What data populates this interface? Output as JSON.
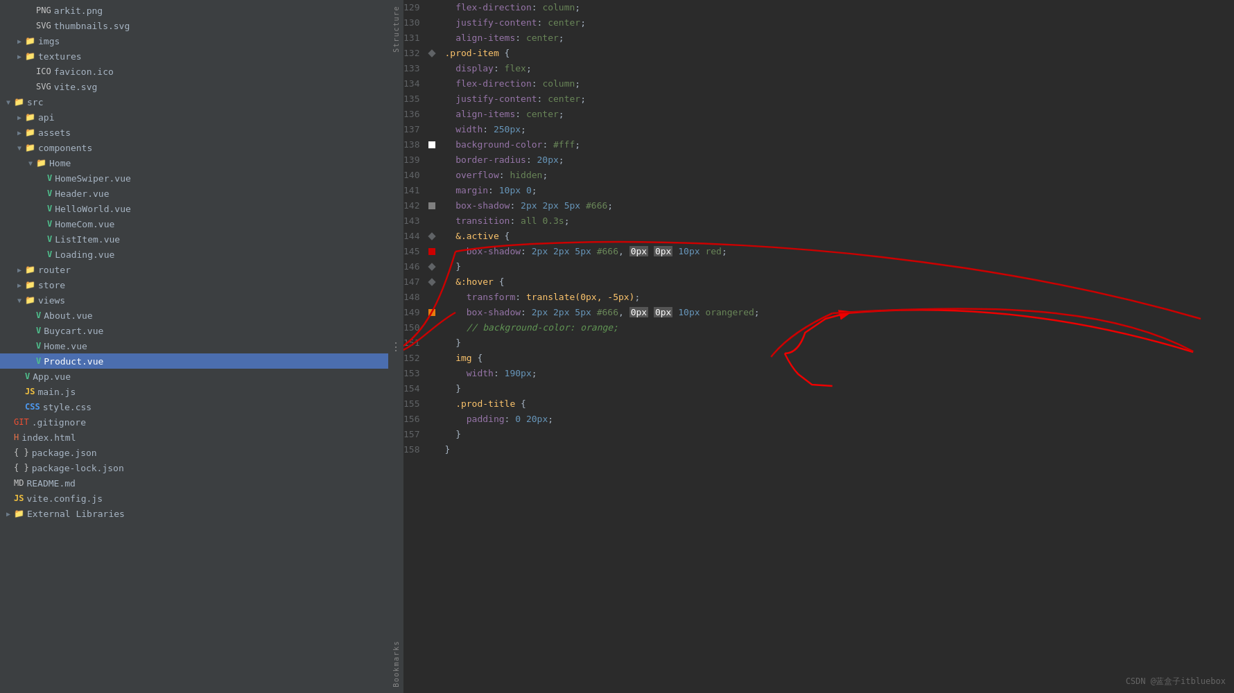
{
  "sidebar": {
    "title": "Structure",
    "bookmarks_label": "Bookmarks",
    "structure_label": "Structure",
    "tree": [
      {
        "id": "arkit-png",
        "indent": 2,
        "type": "file",
        "icon": "img",
        "name": "arkit.png"
      },
      {
        "id": "thumbnails-svg",
        "indent": 2,
        "type": "file",
        "icon": "svg",
        "name": "thumbnails.svg"
      },
      {
        "id": "imgs",
        "indent": 1,
        "type": "folder",
        "icon": "folder",
        "name": "imgs",
        "arrow": "▶"
      },
      {
        "id": "textures",
        "indent": 1,
        "type": "folder",
        "icon": "folder",
        "name": "textures",
        "arrow": "▶"
      },
      {
        "id": "favicon-ico",
        "indent": 2,
        "type": "file",
        "icon": "ico",
        "name": "favicon.ico"
      },
      {
        "id": "vite-svg",
        "indent": 2,
        "type": "file",
        "icon": "svg",
        "name": "vite.svg"
      },
      {
        "id": "src",
        "indent": 0,
        "type": "folder",
        "icon": "folder",
        "name": "src",
        "arrow": "▼"
      },
      {
        "id": "api",
        "indent": 1,
        "type": "folder",
        "icon": "folder",
        "name": "api",
        "arrow": "▶"
      },
      {
        "id": "assets",
        "indent": 1,
        "type": "folder",
        "icon": "folder",
        "name": "assets",
        "arrow": "▶"
      },
      {
        "id": "components",
        "indent": 1,
        "type": "folder",
        "icon": "folder",
        "name": "components",
        "arrow": "▼"
      },
      {
        "id": "home-folder",
        "indent": 2,
        "type": "folder",
        "icon": "folder",
        "name": "Home",
        "arrow": "▼"
      },
      {
        "id": "homeswiper-vue",
        "indent": 3,
        "type": "file",
        "icon": "vue",
        "name": "HomeSwiper.vue"
      },
      {
        "id": "header-vue",
        "indent": 3,
        "type": "file",
        "icon": "vue",
        "name": "Header.vue"
      },
      {
        "id": "helloworld-vue",
        "indent": 3,
        "type": "file",
        "icon": "vue",
        "name": "HelloWorld.vue"
      },
      {
        "id": "homecom-vue",
        "indent": 3,
        "type": "file",
        "icon": "vue",
        "name": "HomeCom.vue"
      },
      {
        "id": "listitem-vue",
        "indent": 3,
        "type": "file",
        "icon": "vue",
        "name": "ListItem.vue"
      },
      {
        "id": "loading-vue",
        "indent": 3,
        "type": "file",
        "icon": "vue",
        "name": "Loading.vue"
      },
      {
        "id": "router",
        "indent": 1,
        "type": "folder",
        "icon": "folder",
        "name": "router",
        "arrow": "▶"
      },
      {
        "id": "store",
        "indent": 1,
        "type": "folder",
        "icon": "folder",
        "name": "store",
        "arrow": "▶"
      },
      {
        "id": "views",
        "indent": 1,
        "type": "folder",
        "icon": "folder",
        "name": "views",
        "arrow": "▼"
      },
      {
        "id": "about-vue",
        "indent": 2,
        "type": "file",
        "icon": "vue",
        "name": "About.vue"
      },
      {
        "id": "buycart-vue",
        "indent": 2,
        "type": "file",
        "icon": "vue",
        "name": "Buycart.vue"
      },
      {
        "id": "home-vue",
        "indent": 2,
        "type": "file",
        "icon": "vue",
        "name": "Home.vue"
      },
      {
        "id": "product-vue",
        "indent": 2,
        "type": "file",
        "icon": "vue",
        "name": "Product.vue",
        "selected": true
      },
      {
        "id": "app-vue",
        "indent": 1,
        "type": "file",
        "icon": "vue",
        "name": "App.vue"
      },
      {
        "id": "main-js",
        "indent": 1,
        "type": "file",
        "icon": "js",
        "name": "main.js"
      },
      {
        "id": "style-css",
        "indent": 1,
        "type": "file",
        "icon": "css",
        "name": "style.css"
      },
      {
        "id": "gitignore",
        "indent": 0,
        "type": "file",
        "icon": "git",
        "name": ".gitignore"
      },
      {
        "id": "index-html",
        "indent": 0,
        "type": "file",
        "icon": "html",
        "name": "index.html"
      },
      {
        "id": "package-json",
        "indent": 0,
        "type": "file",
        "icon": "json",
        "name": "package.json"
      },
      {
        "id": "package-lock-json",
        "indent": 0,
        "type": "file",
        "icon": "json",
        "name": "package-lock.json"
      },
      {
        "id": "readme-md",
        "indent": 0,
        "type": "file",
        "icon": "md",
        "name": "README.md"
      },
      {
        "id": "vite-config-js",
        "indent": 0,
        "type": "file",
        "icon": "js",
        "name": "vite.config.js"
      },
      {
        "id": "external-libs",
        "indent": 0,
        "type": "folder",
        "icon": "folder",
        "name": "External Libraries",
        "arrow": "▶"
      }
    ]
  },
  "editor": {
    "lines": [
      {
        "num": 129,
        "gutter": "none",
        "code": "  flex-direction: column;",
        "tokens": [
          {
            "text": "  ",
            "class": ""
          },
          {
            "text": "flex-direction",
            "class": "c-property"
          },
          {
            "text": ": ",
            "class": "c-colon"
          },
          {
            "text": "column",
            "class": "c-value"
          },
          {
            "text": ";",
            "class": "c-white"
          }
        ]
      },
      {
        "num": 130,
        "gutter": "none",
        "code": "  justify-content: center;",
        "tokens": [
          {
            "text": "  ",
            "class": ""
          },
          {
            "text": "justify-content",
            "class": "c-property"
          },
          {
            "text": ": ",
            "class": "c-colon"
          },
          {
            "text": "center",
            "class": "c-value"
          },
          {
            "text": ";",
            "class": "c-white"
          }
        ]
      },
      {
        "num": 131,
        "gutter": "none",
        "code": "  align-items: center;",
        "tokens": [
          {
            "text": "  ",
            "class": ""
          },
          {
            "text": "align-items",
            "class": "c-property"
          },
          {
            "text": ": ",
            "class": "c-colon"
          },
          {
            "text": "center",
            "class": "c-value"
          },
          {
            "text": ";",
            "class": "c-white"
          }
        ]
      },
      {
        "num": 132,
        "gutter": "diamond",
        "code": ".prod-item {",
        "tokens": [
          {
            "text": ".prod-item ",
            "class": "c-selector"
          },
          {
            "text": "{",
            "class": "c-brace"
          }
        ]
      },
      {
        "num": 133,
        "gutter": "none",
        "code": "  display: flex;",
        "tokens": [
          {
            "text": "  ",
            "class": ""
          },
          {
            "text": "display",
            "class": "c-property"
          },
          {
            "text": ": ",
            "class": "c-colon"
          },
          {
            "text": "flex",
            "class": "c-value"
          },
          {
            "text": ";",
            "class": "c-white"
          }
        ]
      },
      {
        "num": 134,
        "gutter": "none",
        "code": "  flex-direction: column;",
        "tokens": [
          {
            "text": "  ",
            "class": ""
          },
          {
            "text": "flex-direction",
            "class": "c-property"
          },
          {
            "text": ": ",
            "class": "c-colon"
          },
          {
            "text": "column",
            "class": "c-value"
          },
          {
            "text": ";",
            "class": "c-white"
          }
        ]
      },
      {
        "num": 135,
        "gutter": "none",
        "code": "  justify-content: center;",
        "tokens": [
          {
            "text": "  ",
            "class": ""
          },
          {
            "text": "justify-content",
            "class": "c-property"
          },
          {
            "text": ": ",
            "class": "c-colon"
          },
          {
            "text": "center",
            "class": "c-value"
          },
          {
            "text": ";",
            "class": "c-white"
          }
        ]
      },
      {
        "num": 136,
        "gutter": "none",
        "code": "  align-items: center;",
        "tokens": [
          {
            "text": "  ",
            "class": ""
          },
          {
            "text": "align-items",
            "class": "c-property"
          },
          {
            "text": ": ",
            "class": "c-colon"
          },
          {
            "text": "center",
            "class": "c-value"
          },
          {
            "text": ";",
            "class": "c-white"
          }
        ]
      },
      {
        "num": 137,
        "gutter": "none",
        "code": "  width: 250px;",
        "tokens": [
          {
            "text": "  ",
            "class": ""
          },
          {
            "text": "width",
            "class": "c-property"
          },
          {
            "text": ": ",
            "class": "c-colon"
          },
          {
            "text": "250px",
            "class": "c-number"
          },
          {
            "text": ";",
            "class": "c-white"
          }
        ]
      },
      {
        "num": 138,
        "gutter": "white_swatch",
        "code": "  background-color: #fff;",
        "tokens": [
          {
            "text": "  ",
            "class": ""
          },
          {
            "text": "background-color",
            "class": "c-property"
          },
          {
            "text": ": ",
            "class": "c-colon"
          },
          {
            "text": "#fff",
            "class": "c-hash"
          },
          {
            "text": ";",
            "class": "c-white"
          }
        ]
      },
      {
        "num": 139,
        "gutter": "none",
        "code": "  border-radius: 20px;",
        "tokens": [
          {
            "text": "  ",
            "class": ""
          },
          {
            "text": "border-radius",
            "class": "c-property"
          },
          {
            "text": ": ",
            "class": "c-colon"
          },
          {
            "text": "20px",
            "class": "c-number"
          },
          {
            "text": ";",
            "class": "c-white"
          }
        ]
      },
      {
        "num": 140,
        "gutter": "none",
        "code": "  overflow: hidden;",
        "tokens": [
          {
            "text": "  ",
            "class": ""
          },
          {
            "text": "overflow",
            "class": "c-property"
          },
          {
            "text": ": ",
            "class": "c-colon"
          },
          {
            "text": "hidden",
            "class": "c-value"
          },
          {
            "text": ";",
            "class": "c-white"
          }
        ]
      },
      {
        "num": 141,
        "gutter": "none",
        "code": "  margin: 10px 0;",
        "tokens": [
          {
            "text": "  ",
            "class": ""
          },
          {
            "text": "margin",
            "class": "c-property"
          },
          {
            "text": ": ",
            "class": "c-colon"
          },
          {
            "text": "10px 0",
            "class": "c-number"
          },
          {
            "text": ";",
            "class": "c-white"
          }
        ]
      },
      {
        "num": 142,
        "gutter": "gray_swatch",
        "code": "  box-shadow: 2px 2px 5px #666;",
        "tokens": [
          {
            "text": "  ",
            "class": ""
          },
          {
            "text": "box-shadow",
            "class": "c-property"
          },
          {
            "text": ": ",
            "class": "c-colon"
          },
          {
            "text": "2px 2px 5px ",
            "class": "c-number"
          },
          {
            "text": "#666",
            "class": "c-hash"
          },
          {
            "text": ";",
            "class": "c-white"
          }
        ]
      },
      {
        "num": 143,
        "gutter": "none",
        "code": "  transition: all 0.3s;",
        "tokens": [
          {
            "text": "  ",
            "class": ""
          },
          {
            "text": "transition",
            "class": "c-property"
          },
          {
            "text": ": ",
            "class": "c-colon"
          },
          {
            "text": "all 0.3s",
            "class": "c-value"
          },
          {
            "text": ";",
            "class": "c-white"
          }
        ]
      },
      {
        "num": 144,
        "gutter": "diamond",
        "code": "  &.active {",
        "tokens": [
          {
            "text": "  ",
            "class": ""
          },
          {
            "text": "&.active ",
            "class": "c-selector"
          },
          {
            "text": "{",
            "class": "c-brace"
          }
        ]
      },
      {
        "num": 145,
        "gutter": "red_swatch",
        "code": "    box-shadow: 2px 2px 5px #666, 0px 0px 10px red;",
        "special": "line145"
      },
      {
        "num": 146,
        "gutter": "diamond",
        "code": "  }",
        "tokens": [
          {
            "text": "  ",
            "class": ""
          },
          {
            "text": "}",
            "class": "c-brace"
          }
        ]
      },
      {
        "num": 147,
        "gutter": "diamond",
        "code": "  &:hover {",
        "tokens": [
          {
            "text": "  ",
            "class": ""
          },
          {
            "text": "&:hover ",
            "class": "c-selector"
          },
          {
            "text": "{",
            "class": "c-brace"
          }
        ]
      },
      {
        "num": 148,
        "gutter": "none",
        "code": "    transform: translate(0px, -5px);",
        "tokens": [
          {
            "text": "    ",
            "class": ""
          },
          {
            "text": "transform",
            "class": "c-property"
          },
          {
            "text": ": ",
            "class": "c-colon"
          },
          {
            "text": "translate(0px, -5px)",
            "class": "c-func"
          },
          {
            "text": ";",
            "class": "c-white"
          }
        ]
      },
      {
        "num": 149,
        "gutter": "orange_swatch",
        "code": "    box-shadow: 2px 2px 5px #666, 0px 0px 10px orangered;",
        "special": "line149"
      },
      {
        "num": 150,
        "gutter": "none",
        "code": "    // background-color: orange;",
        "tokens": [
          {
            "text": "    ",
            "class": ""
          },
          {
            "text": "// background-color: orange;",
            "class": "c-comment"
          }
        ]
      },
      {
        "num": 151,
        "gutter": "none",
        "code": "  }",
        "tokens": [
          {
            "text": "  ",
            "class": ""
          },
          {
            "text": "}",
            "class": "c-brace"
          }
        ]
      },
      {
        "num": 152,
        "gutter": "none",
        "code": "  img {",
        "tokens": [
          {
            "text": "  ",
            "class": ""
          },
          {
            "text": "img ",
            "class": "c-selector"
          },
          {
            "text": "{",
            "class": "c-brace"
          }
        ]
      },
      {
        "num": 153,
        "gutter": "none",
        "code": "    width: 190px;",
        "tokens": [
          {
            "text": "    ",
            "class": ""
          },
          {
            "text": "width",
            "class": "c-property"
          },
          {
            "text": ": ",
            "class": "c-colon"
          },
          {
            "text": "190px",
            "class": "c-number"
          },
          {
            "text": ";",
            "class": "c-white"
          }
        ]
      },
      {
        "num": 154,
        "gutter": "none",
        "code": "  }",
        "tokens": [
          {
            "text": "  ",
            "class": ""
          },
          {
            "text": "}",
            "class": "c-brace"
          }
        ]
      },
      {
        "num": 155,
        "gutter": "none",
        "code": "  .prod-title {",
        "tokens": [
          {
            "text": "  ",
            "class": ""
          },
          {
            "text": ".prod-title ",
            "class": "c-selector"
          },
          {
            "text": "{",
            "class": "c-brace"
          }
        ]
      },
      {
        "num": 156,
        "gutter": "none",
        "code": "    padding: 0 20px;",
        "tokens": [
          {
            "text": "    ",
            "class": ""
          },
          {
            "text": "padding",
            "class": "c-property"
          },
          {
            "text": ": ",
            "class": "c-colon"
          },
          {
            "text": "0 20px",
            "class": "c-number"
          },
          {
            "text": ";",
            "class": "c-white"
          }
        ]
      },
      {
        "num": 157,
        "gutter": "none",
        "code": "  }",
        "tokens": [
          {
            "text": "  ",
            "class": ""
          },
          {
            "text": "}",
            "class": "c-brace"
          }
        ]
      },
      {
        "num": 158,
        "gutter": "none",
        "code": "}",
        "tokens": [
          {
            "text": "}",
            "class": "c-brace"
          }
        ]
      }
    ]
  },
  "watermark": "CSDN @蓝盒子itbluebox"
}
